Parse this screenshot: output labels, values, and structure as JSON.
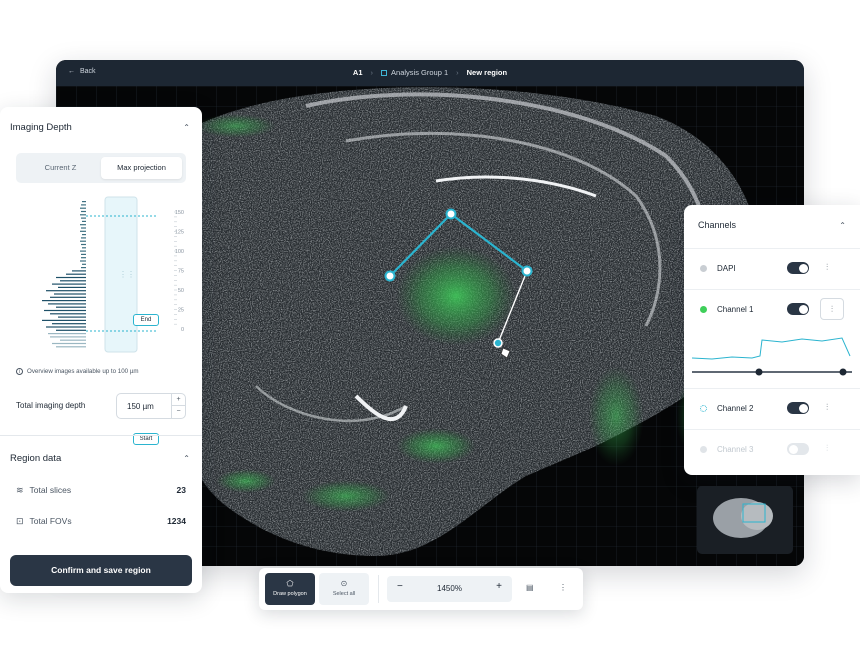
{
  "topbar": {
    "back_label": "Back",
    "breadcrumbs": [
      "A1",
      "Analysis Group 1",
      "New region"
    ]
  },
  "left_panel": {
    "imaging_depth_title": "Imaging Depth",
    "modes": [
      "Current Z",
      "Max projection"
    ],
    "active_mode": "Max projection",
    "depth_handles": {
      "end": "End",
      "start": "Start"
    },
    "depth_scale_ticks": [
      "150",
      "125",
      "100",
      "75",
      "50",
      "25",
      "0"
    ],
    "overview_note": "Overview images available up to 100 µm",
    "total_depth_label": "Total imaging depth",
    "total_depth_value": "150 µm",
    "stepper_up": "+",
    "stepper_down": "−",
    "region_title": "Region data",
    "total_slices_label": "Total slices",
    "total_slices_value": "23",
    "total_fovs_label": "Total FOVs",
    "total_fovs_value": "1234",
    "confirm_label": "Confirm and save region"
  },
  "channels": {
    "title": "Channels",
    "items": [
      {
        "name": "DAPI",
        "color": "#c9ced3",
        "enabled": true
      },
      {
        "name": "Channel 1",
        "color": "#3fcf5a",
        "enabled": true
      },
      {
        "name": "Channel 2",
        "color": "#2bb4cf",
        "enabled": true
      },
      {
        "name": "Channel 3",
        "color": "#e0e4e8",
        "enabled": false
      }
    ]
  },
  "toolbar": {
    "draw_polygon": "Draw polygon",
    "select_all": "Select all",
    "zoom_out": "−",
    "zoom_value": "1450%",
    "zoom_in": "+"
  },
  "colors": {
    "accent": "#2bb4cf",
    "dark": "#2a3645",
    "green_signal": "#3fcf5a"
  }
}
